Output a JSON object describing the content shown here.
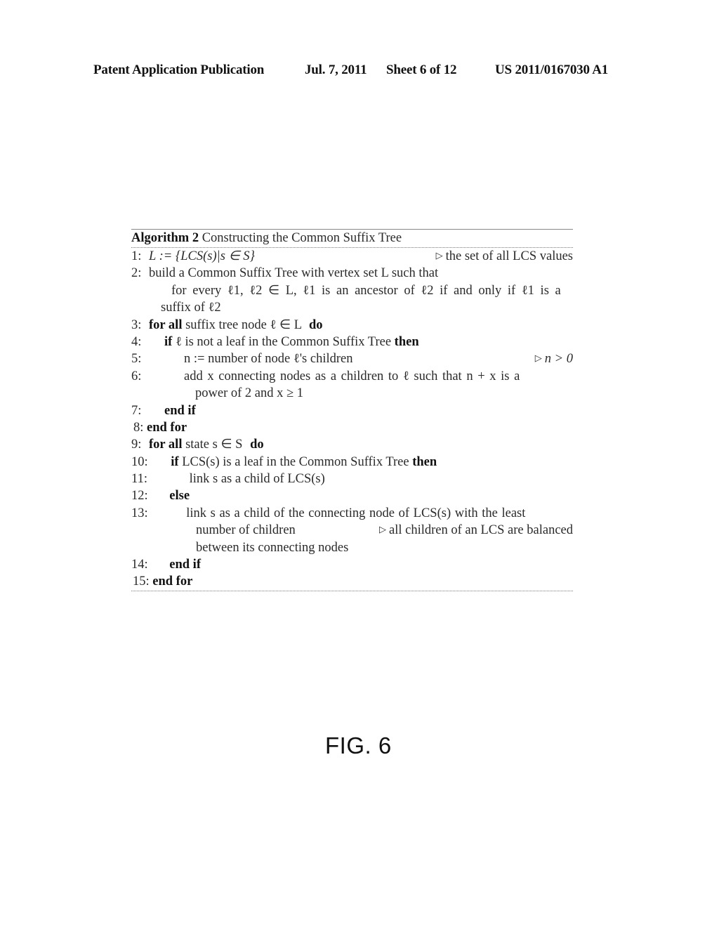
{
  "header": {
    "publication": "Patent Application Publication",
    "date": "Jul. 7, 2011",
    "sheet": "Sheet 6 of 12",
    "number": "US 2011/0167030 A1"
  },
  "algorithm": {
    "label": "Algorithm 2",
    "title": "Constructing the Common Suffix Tree",
    "lines": [
      {
        "num": "1:",
        "text": "L := {LCS(s)|s ∈ S}",
        "comment": "the set of all LCS values"
      },
      {
        "num": "2:",
        "text": "build a Common Suffix Tree with vertex set L such that",
        "cont1": "for every ℓ1, ℓ2 ∈ L, ℓ1 is an ancestor of ℓ2 if and only if ℓ1 is a",
        "cont2": "suffix of ℓ2"
      },
      {
        "num": "3:",
        "kw1": "for all",
        "text": "suffix tree node ℓ ∈ L",
        "kw2": "do"
      },
      {
        "num": "4:",
        "kw1": "if",
        "text": "ℓ is not a leaf in the Common Suffix Tree",
        "kw2": "then"
      },
      {
        "num": "5:",
        "text": "n := number of node ℓ's children",
        "comment": "n > 0"
      },
      {
        "num": "6:",
        "text": "add x connecting nodes as a children to ℓ such that n + x is a",
        "cont1": "power of 2 and x ≥ 1"
      },
      {
        "num": "7:",
        "kw1": "end if"
      },
      {
        "num": "8:",
        "kw1": "end for"
      },
      {
        "num": "9:",
        "kw1": "for all",
        "text": "state s ∈ S",
        "kw2": "do"
      },
      {
        "num": "10:",
        "kw1": "if",
        "text": "LCS(s) is a leaf in the Common Suffix Tree",
        "kw2": "then"
      },
      {
        "num": "11:",
        "text": "link s as a child of LCS(s)"
      },
      {
        "num": "12:",
        "kw1": "else"
      },
      {
        "num": "13:",
        "text": "link s as a child of the connecting node of LCS(s) with the least",
        "cont1": "number of children",
        "comment": "all children of an LCS are balanced",
        "cont2": "between its connecting nodes"
      },
      {
        "num": "14:",
        "kw1": "end if"
      },
      {
        "num": "15:",
        "kw1": "end for"
      }
    ]
  },
  "figure_label": "FIG. 6"
}
